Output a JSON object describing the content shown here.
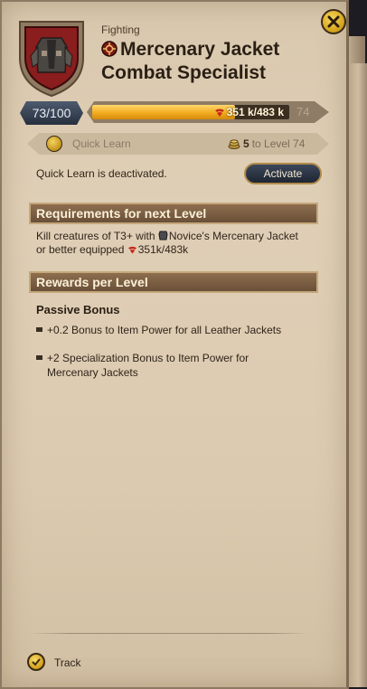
{
  "header": {
    "category": "Fighting",
    "title_line1": "Mercenary Jacket",
    "title_line2": "Combat Specialist"
  },
  "progress": {
    "level_badge": "73/100",
    "fame_text": "351 k/483 k",
    "fame_fraction": 0.727,
    "next_level": "74"
  },
  "quick_learn": {
    "label": "Quick Learn",
    "cost_number": "5",
    "cost_suffix": "to Level 74",
    "status": "Quick Learn is deactivated.",
    "activate_label": "Activate"
  },
  "requirements": {
    "header": "Requirements for next Level",
    "text_part1": "Kill creatures of T3+ with",
    "text_item": "Novice's Mercenary Jacket or better equipped",
    "fame": "351k/483k"
  },
  "rewards": {
    "header": "Rewards per Level",
    "passive_title": "Passive Bonus",
    "bullets": [
      "+0.2 Bonus to Item Power for all Leather Jackets",
      "+2 Specialization Bonus to Item Power for Mercenary Jackets"
    ]
  },
  "footer": {
    "track_label": "Track"
  },
  "icons": {
    "emblem": "mercenary-jacket-shield-icon",
    "close": "close-icon",
    "fighting": "crosshair-icon",
    "quick_learn": "gold-coin-icon",
    "silver": "silver-stack-icon",
    "fame": "fame-icon",
    "jacket": "jacket-icon",
    "track": "check-coin-icon"
  },
  "colors": {
    "panel": "#dccab0",
    "section_header": "#7a5d42",
    "xp_fill": "#f0a81c",
    "button_dark": "#27303e",
    "gold": "#d2a019"
  }
}
